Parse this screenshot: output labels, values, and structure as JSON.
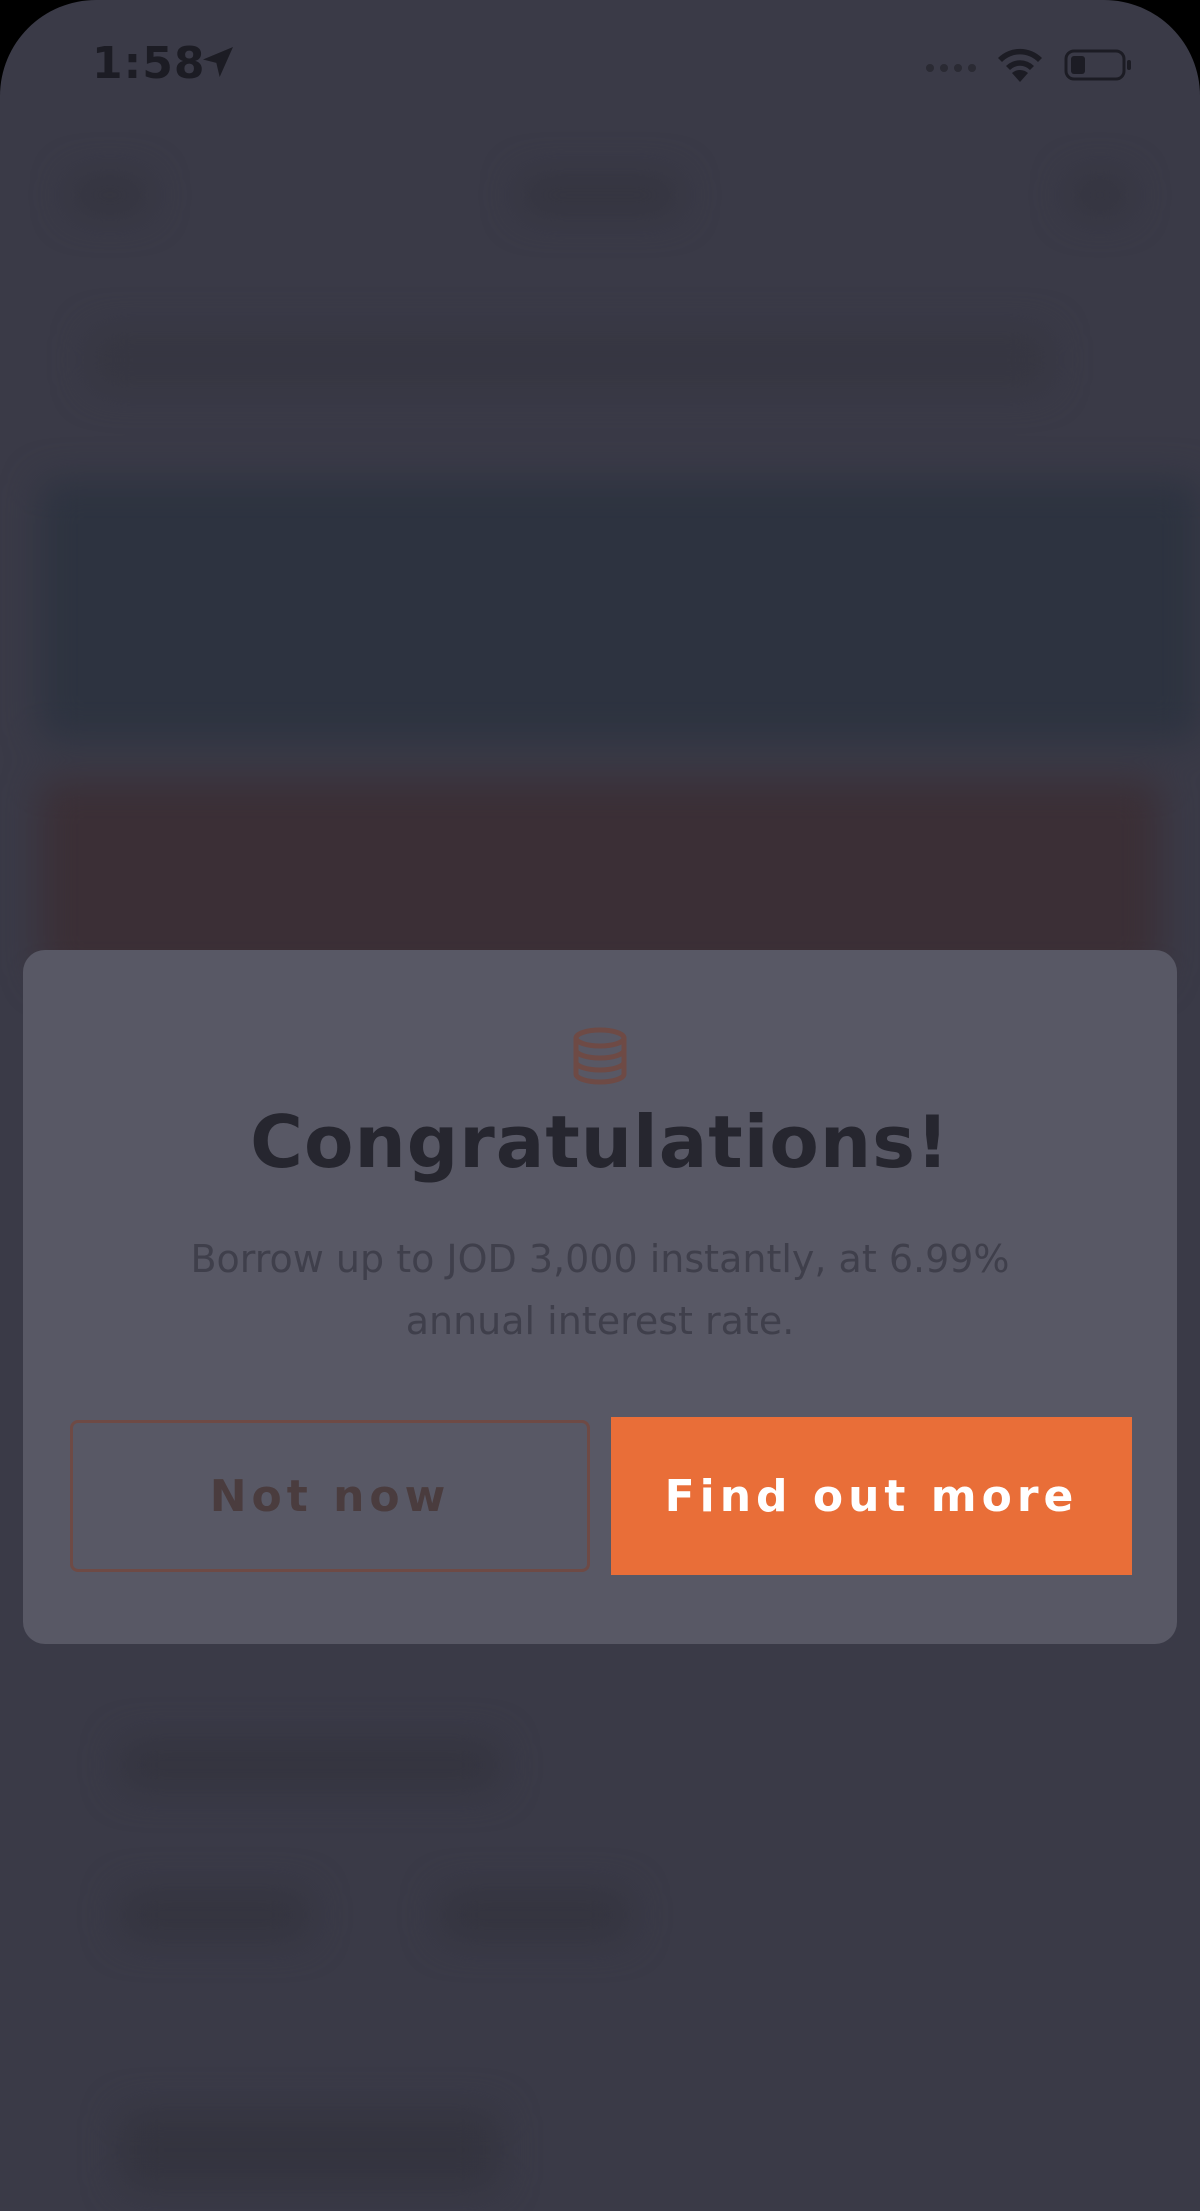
{
  "status_bar": {
    "time": "1:58"
  },
  "dialog": {
    "icon": "coins-stack-icon",
    "title": "Congratulations!",
    "body": "Borrow up to JOD 3,000 instantly, at 6.99% annual interest rate.",
    "secondary_button": "Not now",
    "primary_button": "Find out more"
  },
  "colors": {
    "overlay": "#3a3a47",
    "dialog_background": "#585865",
    "accent": "#e96e38",
    "secondary_border": "#6e4a45"
  }
}
